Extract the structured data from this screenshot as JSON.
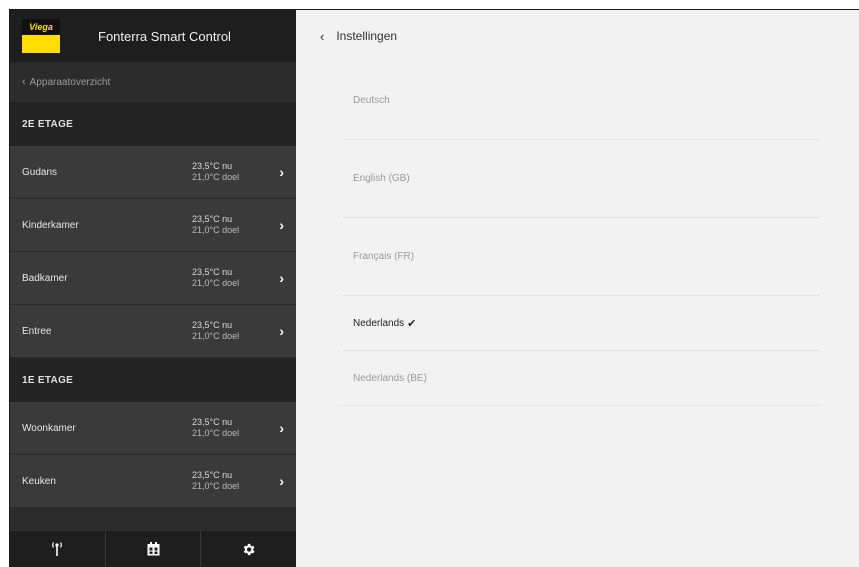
{
  "app": {
    "logo_text": "Viega",
    "title": "Fonterra Smart Control"
  },
  "sidebar": {
    "back_label": "Apparaatoverzicht",
    "floors": [
      {
        "name": "2E ETAGE",
        "rooms": [
          {
            "name": "Gudans",
            "current": "23,5°C nu",
            "target": "21,0°C doel"
          },
          {
            "name": "Kinderkamer",
            "current": "23,5°C nu",
            "target": "21,0°C doel"
          },
          {
            "name": "Badkamer",
            "current": "23,5°C nu",
            "target": "21,0°C doel"
          },
          {
            "name": "Entree",
            "current": "23,5°C nu",
            "target": "21,0°C doel"
          }
        ]
      },
      {
        "name": "1E ETAGE",
        "rooms": [
          {
            "name": "Woonkamer",
            "current": "23,5°C nu",
            "target": "21,0°C doel"
          },
          {
            "name": "Keuken",
            "current": "23,5°C nu",
            "target": "21,0°C doel"
          }
        ]
      }
    ],
    "bottom_nav": [
      "antenna-icon",
      "calendar-icon",
      "gear-icon"
    ]
  },
  "main": {
    "title": "Instellingen",
    "languages": [
      {
        "label": "Deutsch",
        "selected": false
      },
      {
        "label": "English (GB)",
        "selected": false
      },
      {
        "label": "Français (FR)",
        "selected": false
      },
      {
        "label": "Nederlands",
        "selected": true
      },
      {
        "label": "Nederlands (BE)",
        "selected": false
      }
    ]
  },
  "colors": {
    "brand_yellow": "#ffdd00",
    "sidebar_bg": "#2c2c2c",
    "main_bg": "#f2f2f2"
  }
}
